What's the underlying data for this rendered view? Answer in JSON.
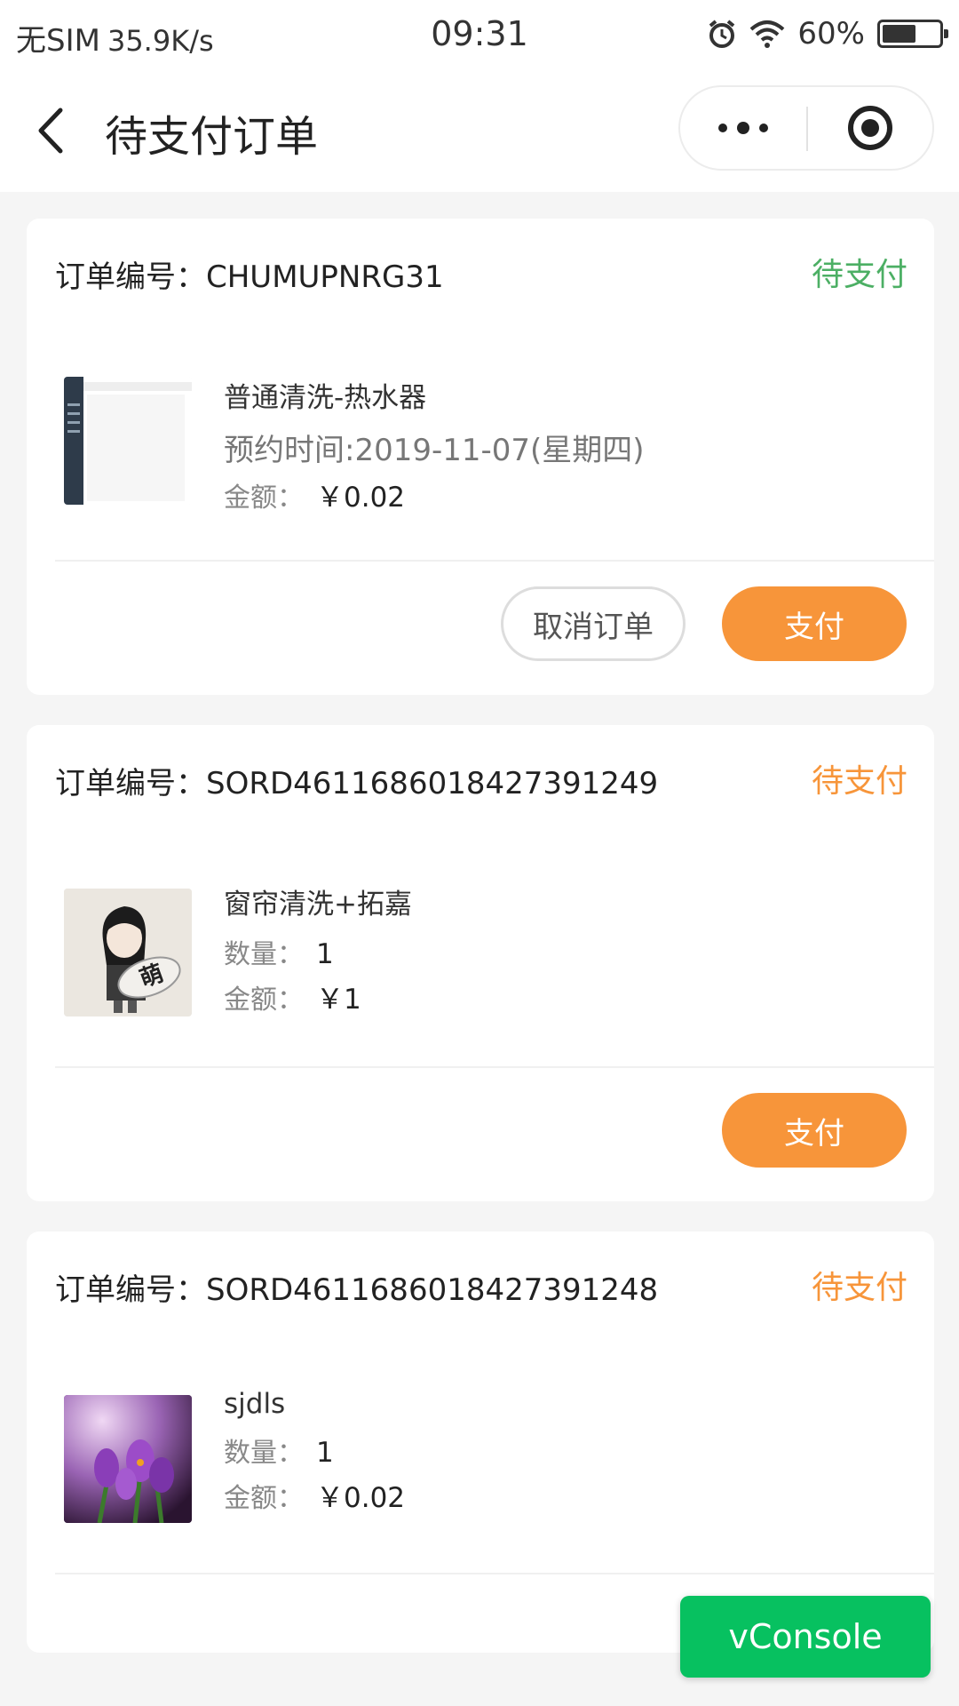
{
  "status_bar": {
    "carrier": "无SIM",
    "speed": "35.9K/s",
    "time": "09:31",
    "battery": "60%",
    "battery_level": 0.6
  },
  "nav": {
    "title": "待支付订单",
    "icons": [
      "back-icon",
      "more-dots-icon",
      "target-icon"
    ]
  },
  "orders": [
    {
      "order_no": "订单编号：CHUMUPNRG31",
      "status": "待支付",
      "status_color": "#4caf64",
      "product_name": "普通清洗-热水器",
      "appointment": "预约时间:2019-11-07(星期四)",
      "amount_label": "金额：",
      "amount": "￥0.02",
      "cancel_label": "取消订单",
      "pay_label": "支付"
    },
    {
      "order_no": "订单编号：SORD4611686018427391249",
      "status": "待支付",
      "status_color": "#f7953a",
      "product_name": "窗帘清洗+拓嘉",
      "qty_label": "数量：",
      "qty": "1",
      "amount_label": "金额：",
      "amount": "￥1",
      "pay_label": "支付"
    },
    {
      "order_no": "订单编号：SORD4611686018427391248",
      "status": "待支付",
      "status_color": "#f7953a",
      "product_name": "sjdls",
      "qty_label": "数量：",
      "qty": "1",
      "amount_label": "金额：",
      "amount": "￥0.02"
    }
  ],
  "vconsole": "vConsole",
  "colors": {
    "pay_button": "#f7953a",
    "vconsole": "#07c160"
  }
}
